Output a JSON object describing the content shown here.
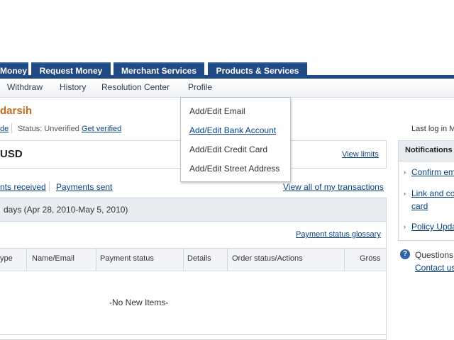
{
  "tabs": [
    {
      "label": "Money"
    },
    {
      "label": "Request Money"
    },
    {
      "label": "Merchant Services"
    },
    {
      "label": "Products & Services"
    }
  ],
  "subnav": [
    "Withdraw",
    "History",
    "Resolution Center",
    "Profile"
  ],
  "profile_menu": [
    "Add/Edit Email",
    "Add/Edit Bank Account",
    "Add/Edit Credit Card",
    "Add/Edit Street Address"
  ],
  "account": {
    "name": "darsih",
    "status_prefix": "de",
    "status_label": "Status: Unverified",
    "get_verified": "Get verified",
    "balance": "USD",
    "view_limits": "View limits"
  },
  "transactions": {
    "links": [
      "nts received",
      "Payments sent"
    ],
    "view_all": "View all of my transactions",
    "date_range": "days (Apr 28, 2010-May 5, 2010)",
    "glossary": "Payment status glossary",
    "columns": [
      "ype",
      "Name/Email",
      "Payment status",
      "Details",
      "Order status/Actions",
      "Gross"
    ],
    "empty": "-No New Items-"
  },
  "right": {
    "last_log": "Last log in M",
    "notifications_title": "Notifications",
    "items": [
      "Confirm em",
      "Link and co",
      "card",
      "Policy Upda"
    ],
    "questions": "Questions",
    "contact": "Contact us"
  }
}
